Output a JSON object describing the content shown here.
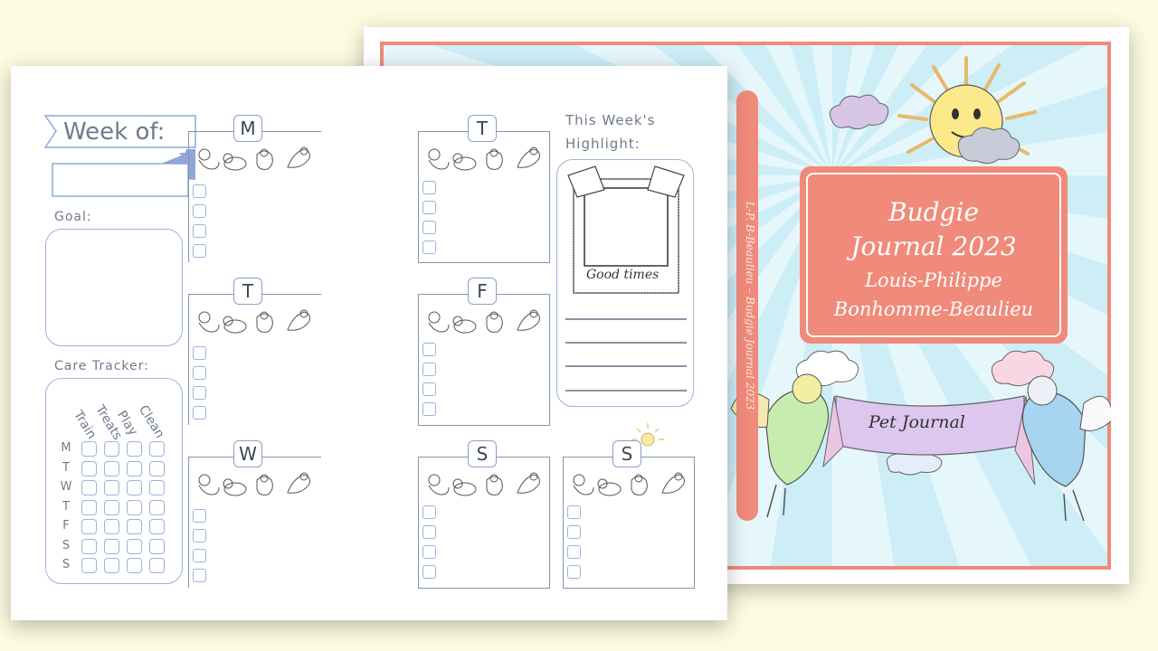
{
  "cover": {
    "title_line1": "Budgie",
    "title_line2": "Journal 2023",
    "author_line1": "Louis-Philippe",
    "author_line2": "Bonhomme-Beaulieu",
    "spine_text": "L-P. B-Beaulieu – Budgie Journal 2023",
    "banner_text": "Pet Journal"
  },
  "planner": {
    "week_of_label": "Week of:",
    "goal_label": "Goal:",
    "care_tracker_label": "Care Tracker:",
    "care_columns": [
      "Train",
      "Treats",
      "Play",
      "Clean"
    ],
    "care_rows": [
      "M",
      "T",
      "W",
      "T",
      "F",
      "S",
      "S"
    ],
    "days": [
      "M",
      "T",
      "W",
      "T",
      "F",
      "S",
      "S"
    ],
    "highlight_label_line1": "This Week's",
    "highlight_label_line2": "Highlight:",
    "polaroid_caption": "Good times"
  },
  "colors": {
    "background": "#fdfbe0",
    "accent_coral": "#f08a7a",
    "sky_blue": "#cdeef7",
    "ink_blue": "#8a9fc8",
    "ribbon_blue": "#8ea7d8"
  }
}
